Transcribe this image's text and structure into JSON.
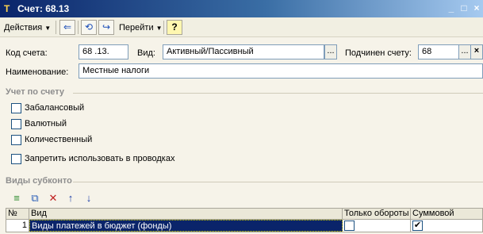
{
  "window": {
    "title": "Счет: 68.13",
    "minimize": "_",
    "maximize": "□",
    "close": "×"
  },
  "toolbar": {
    "actions_label": "Действия",
    "goto_label": "Перейти",
    "help_label": "?"
  },
  "form": {
    "code_label": "Код счета:",
    "code_value": "68 .13.",
    "kind_label": "Вид:",
    "kind_value": "Активный/Пассивный",
    "parent_label": "Подчинен счету:",
    "parent_value": "68",
    "name_label": "Наименование:",
    "name_value": "Местные налоги"
  },
  "accounting": {
    "section_title": "Учет по счету",
    "offbalance_label": "Забалансовый",
    "offbalance_checked": false,
    "currency_label": "Валютный",
    "currency_checked": false,
    "quantity_label": "Количественный",
    "quantity_checked": false,
    "forbid_label": "Запретить использовать в проводках",
    "forbid_checked": false
  },
  "subconto": {
    "section_title": "Виды субконто",
    "columns": {
      "num": "№",
      "kind": "Вид",
      "turnover_only": "Только обороты",
      "sum": "Суммовой"
    },
    "rows": [
      {
        "num": "1",
        "kind": "Виды платежей в бюджет (фонды)",
        "turnover_only": false,
        "sum": true
      }
    ]
  }
}
